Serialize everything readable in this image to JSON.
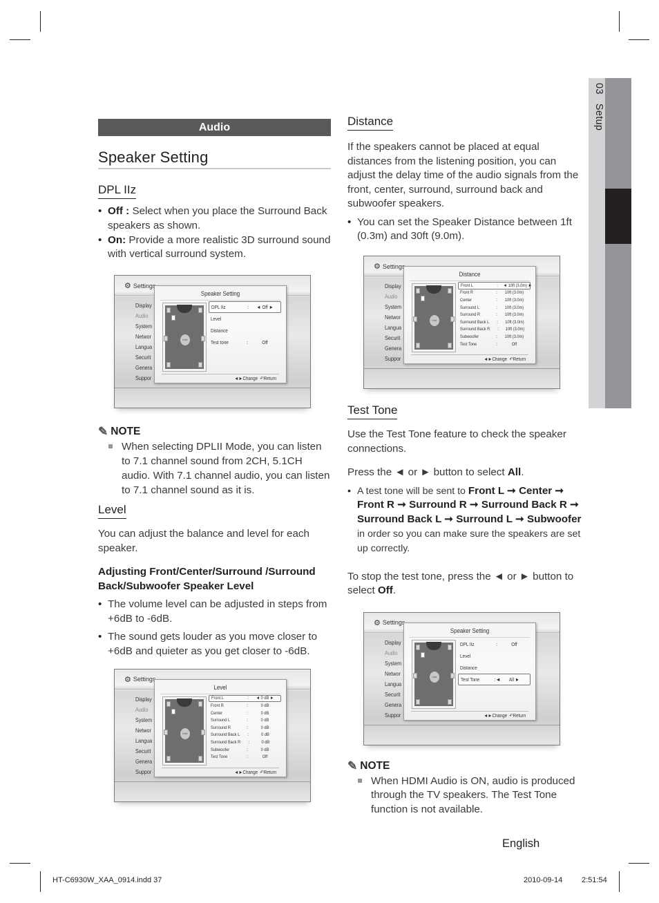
{
  "side_tab": {
    "chapter_number": "03",
    "chapter_title": "Setup"
  },
  "left": {
    "section_bar": "Audio",
    "page_title": "Speaker Setting",
    "dpl": {
      "heading": "DPL IIz",
      "bullets": [
        {
          "term": "Off :",
          "text": " Select when you place the Surround Back speakers as shown."
        },
        {
          "term": "On:",
          "text": " Provide a more realistic 3D surround sound with vertical surround system."
        }
      ]
    },
    "note": {
      "label": "NOTE",
      "items": [
        "When selecting DPLII Mode, you can listen to 7.1 channel sound from 2CH, 5.1CH audio. With 7.1 channel audio, you can listen to 7.1 channel sound as it is."
      ]
    },
    "level": {
      "heading": "Level",
      "intro": "You can adjust the balance and level for each speaker.",
      "subheading": "Adjusting Front/Center/Surround /Surround Back/Subwoofer Speaker Level",
      "bullets": [
        "The volume level can be adjusted in steps from +6dB to -6dB.",
        "The sound gets louder as you move closer to +6dB and quieter as you get closer to -6dB."
      ]
    }
  },
  "right": {
    "distance": {
      "heading": "Distance",
      "intro": "If the speakers cannot be placed at equal distances from the listening position, you can adjust the delay time of the audio signals from the front, center, surround, surround back and subwoofer speakers.",
      "bullets": [
        "You can set the Speaker Distance between 1ft (0.3m) and 30ft (9.0m)."
      ]
    },
    "test_tone": {
      "heading": "Test Tone",
      "intro": "Use the Test Tone feature to check the speaker connections.",
      "press_prefix": "Press the ◄ or ► button to select ",
      "press_bold": "All",
      "press_suffix": ".",
      "bullet_prefix": "A test tone will be sent to ",
      "bullet_bold": "Front L ➞ Center ➞ Front R ➞ Surround R ➞ Surround Back R ➞ Surround Back L ➞ Surround L ➞ Subwoofer",
      "bullet_suffix": " in order so you can make sure the speakers are set up correctly.",
      "stop_prefix": "To stop the test tone, press the ◄ or ► button to select ",
      "stop_bold": "Off",
      "stop_suffix": "."
    },
    "note": {
      "label": "NOTE",
      "items": [
        "When HDMI Audio is ON, audio is produced through the TV speakers. The Test Tone function is not available."
      ]
    }
  },
  "screens": {
    "common": {
      "header": "Settings",
      "menu": [
        "Display",
        "Audio",
        "System",
        "Network",
        "Language",
        "Security",
        "General",
        "Support"
      ],
      "menu_visible": [
        "Display",
        "Audio",
        "System",
        "Networ",
        "Langua",
        "Securit",
        "Genera",
        "Suppor"
      ],
      "change_label": "◄►Change",
      "return_label": "Return"
    },
    "speaker_setting_1": {
      "title": "Speaker Setting",
      "rows": [
        {
          "label": "DPL IIz",
          "sep": ":",
          "value": "◄  Off  ►",
          "selected": true
        },
        {
          "label": "Level",
          "sep": "",
          "value": ""
        },
        {
          "label": "Distance",
          "sep": "",
          "value": ""
        },
        {
          "label": "Test tone",
          "sep": ":",
          "value": "Off"
        }
      ]
    },
    "distance": {
      "title": "Distance",
      "rows": [
        {
          "label": "Front L",
          "sep": ":",
          "value": "◄ 10ft (3.0m) ►",
          "selected": true
        },
        {
          "label": "Front R",
          "sep": ":",
          "value": "10ft (3.0m)"
        },
        {
          "label": "Center",
          "sep": ":",
          "value": "10ft (3.0m)"
        },
        {
          "label": "Surround L",
          "sep": ":",
          "value": "10ft (3.0m)"
        },
        {
          "label": "Surround R",
          "sep": ":",
          "value": "10ft (3.0m)"
        },
        {
          "label": "Surround Back L",
          "sep": ":",
          "value": "10ft (3.0m)"
        },
        {
          "label": "Surround Back R",
          "sep": ":",
          "value": "10ft (3.0m)"
        },
        {
          "label": "Subwoofer",
          "sep": ":",
          "value": "10ft (3.0m)"
        },
        {
          "label": "Test Tone",
          "sep": ":",
          "value": "Off"
        }
      ]
    },
    "level": {
      "title": "Level",
      "rows": [
        {
          "label": "Front L",
          "sep": ":",
          "value": "◄ 0 dB ►",
          "selected": true
        },
        {
          "label": "Front R",
          "sep": ":",
          "value": "0 dB"
        },
        {
          "label": "Center",
          "sep": ":",
          "value": "0 dB"
        },
        {
          "label": "Surround L",
          "sep": ":",
          "value": "0 dB"
        },
        {
          "label": "Surround R",
          "sep": ":",
          "value": "0 dB"
        },
        {
          "label": "Surround Back L",
          "sep": ":",
          "value": "0 dB"
        },
        {
          "label": "Surround Back R",
          "sep": ":",
          "value": "0 dB"
        },
        {
          "label": "Subwoofer",
          "sep": ":",
          "value": "0 dB"
        },
        {
          "label": "Test Tone",
          "sep": ":",
          "value": "Off"
        }
      ]
    },
    "speaker_setting_2": {
      "title": "Speaker Setting",
      "rows": [
        {
          "label": "DPL IIz",
          "sep": ":",
          "value": "Off"
        },
        {
          "label": "Level",
          "sep": "",
          "value": ""
        },
        {
          "label": "Distance",
          "sep": "",
          "value": ""
        },
        {
          "label": "Test Tone",
          "sep": ":◄",
          "value": "All   ►",
          "selected": true
        }
      ]
    }
  },
  "footer": {
    "language": "English",
    "slug_file": "HT-C6930W_XAA_0914.indd   37",
    "slug_date": "2010-09-14",
    "slug_time": "2:51:54"
  }
}
